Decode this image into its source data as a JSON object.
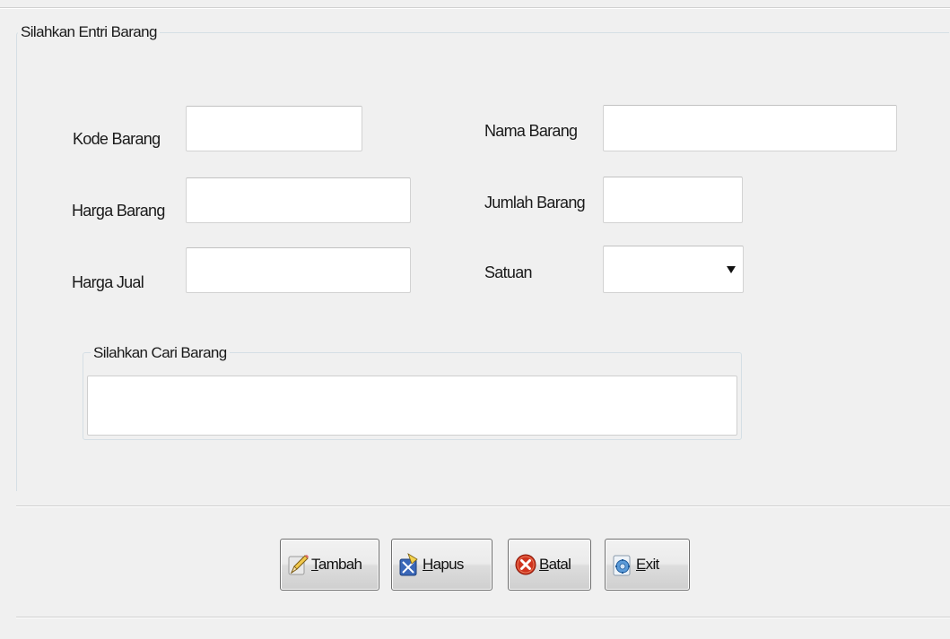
{
  "form": {
    "group_title": "Silahkan Entri Barang",
    "fields": {
      "kode_barang": {
        "label": "Kode Barang",
        "value": ""
      },
      "nama_barang": {
        "label": "Nama Barang",
        "value": ""
      },
      "harga_barang": {
        "label": "Harga Barang",
        "value": ""
      },
      "jumlah_barang": {
        "label": "Jumlah Barang",
        "value": ""
      },
      "harga_jual": {
        "label": "Harga Jual",
        "value": ""
      },
      "satuan": {
        "label": "Satuan",
        "value": ""
      }
    },
    "search": {
      "group_title": "Silahkan Cari Barang",
      "value": ""
    }
  },
  "buttons": {
    "tambah": {
      "mnemonic": "T",
      "rest": "ambah",
      "icon": "pencil-icon"
    },
    "hapus": {
      "mnemonic": "H",
      "rest": "apus",
      "icon": "delete-icon"
    },
    "batal": {
      "mnemonic": "B",
      "rest": "atal",
      "icon": "cancel-icon"
    },
    "exit": {
      "mnemonic": "E",
      "rest": "xit",
      "icon": "exit-icon"
    }
  },
  "colors": {
    "window_bg": "#f0f0f0",
    "groupbox_border": "#d5dfe5",
    "batal_icon": "#d0341f",
    "hapus_icon": "#3a67b8"
  }
}
